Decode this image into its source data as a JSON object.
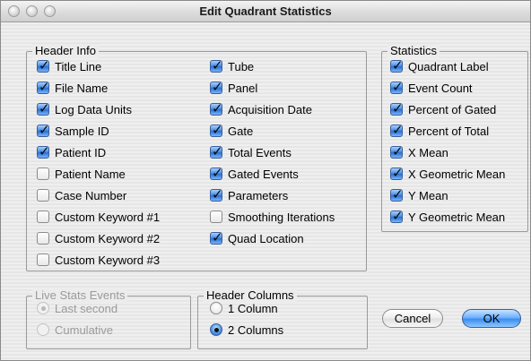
{
  "window": {
    "title": "Edit Quadrant Statistics"
  },
  "header_info": {
    "legend": "Header Info",
    "left": [
      {
        "label": "Title Line",
        "checked": true
      },
      {
        "label": "File Name",
        "checked": true
      },
      {
        "label": "Log Data Units",
        "checked": true
      },
      {
        "label": "Sample ID",
        "checked": true
      },
      {
        "label": "Patient ID",
        "checked": true
      },
      {
        "label": "Patient Name",
        "checked": false
      },
      {
        "label": "Case Number",
        "checked": false
      },
      {
        "label": "Custom Keyword #1",
        "checked": false
      },
      {
        "label": "Custom Keyword #2",
        "checked": false
      },
      {
        "label": "Custom Keyword #3",
        "checked": false
      }
    ],
    "right": [
      {
        "label": "Tube",
        "checked": true
      },
      {
        "label": "Panel",
        "checked": true
      },
      {
        "label": "Acquisition Date",
        "checked": true
      },
      {
        "label": "Gate",
        "checked": true
      },
      {
        "label": "Total Events",
        "checked": true
      },
      {
        "label": "Gated Events",
        "checked": true
      },
      {
        "label": "Parameters",
        "checked": true
      },
      {
        "label": "Smoothing Iterations",
        "checked": false
      },
      {
        "label": "Quad Location",
        "checked": true
      }
    ]
  },
  "statistics": {
    "legend": "Statistics",
    "items": [
      {
        "label": "Quadrant Label",
        "checked": true
      },
      {
        "label": "Event Count",
        "checked": true
      },
      {
        "label": "Percent of Gated",
        "checked": true
      },
      {
        "label": "Percent of Total",
        "checked": true
      },
      {
        "label": "X Mean",
        "checked": true
      },
      {
        "label": "X Geometric Mean",
        "checked": true
      },
      {
        "label": "Y Mean",
        "checked": true
      },
      {
        "label": "Y Geometric Mean",
        "checked": true
      }
    ]
  },
  "live_stats": {
    "legend": "Live Stats Events",
    "disabled": true,
    "options": [
      {
        "label": "Last second",
        "selected": true
      },
      {
        "label": "Cumulative",
        "selected": false
      }
    ]
  },
  "header_columns": {
    "legend": "Header Columns",
    "options": [
      {
        "label": "1 Column",
        "selected": false
      },
      {
        "label": "2 Columns",
        "selected": true
      }
    ]
  },
  "buttons": {
    "cancel": "Cancel",
    "ok": "OK"
  },
  "colors": {
    "accent": "#3c8dee",
    "disabled_text": "#9a9a9a",
    "group_border": "#9a9a9a"
  }
}
